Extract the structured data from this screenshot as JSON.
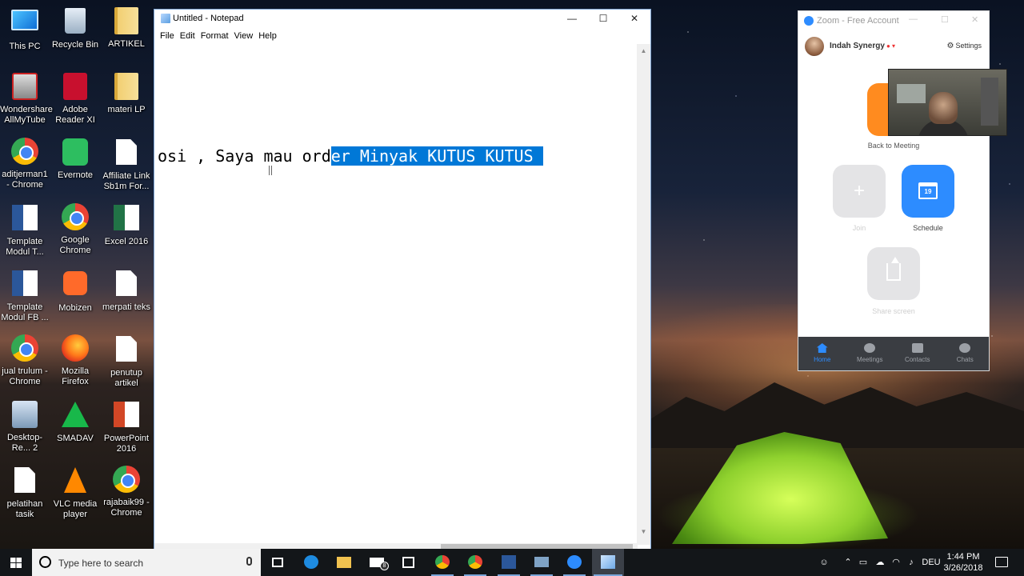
{
  "desktop": {
    "icons": [
      {
        "label": "This PC"
      },
      {
        "label": "Recycle Bin"
      },
      {
        "label": "ARTIKEL"
      },
      {
        "label": "Wondershare AllMyTube"
      },
      {
        "label": "Adobe Reader XI"
      },
      {
        "label": "materi LP"
      },
      {
        "label": "aditjerman1 - Chrome"
      },
      {
        "label": "Evernote"
      },
      {
        "label": "Affiliate Link Sb1m For..."
      },
      {
        "label": "Template Modul T..."
      },
      {
        "label": "Google Chrome"
      },
      {
        "label": "Excel 2016"
      },
      {
        "label": "Template Modul FB ..."
      },
      {
        "label": "Mobizen"
      },
      {
        "label": "merpati teks"
      },
      {
        "label": "jual trulum - Chrome"
      },
      {
        "label": "Mozilla Firefox"
      },
      {
        "label": "penutup artikel"
      },
      {
        "label": "Desktop-Re... 2"
      },
      {
        "label": "SMADAV"
      },
      {
        "label": "PowerPoint 2016"
      },
      {
        "label": "pelatihan tasik"
      },
      {
        "label": "VLC media player"
      },
      {
        "label": "rajabaik99 - Chrome"
      }
    ]
  },
  "notepad": {
    "title": "Untitled - Notepad",
    "menu": [
      "File",
      "Edit",
      "Format",
      "View",
      "Help"
    ],
    "text_before_selection": "osi , Saya mau ord",
    "selected_text": "er Minyak KUTUS KUTUS ",
    "controls": {
      "minimize": "—",
      "maximize": "☐",
      "close": "✕"
    }
  },
  "zoom": {
    "title": "Zoom - Free Account",
    "user_name": "Indah Synergy",
    "status_marker": "● ▾",
    "settings_label": "Settings",
    "back_to_meeting": "Back to Meeting",
    "join_label": "Join",
    "schedule_label": "Schedule",
    "calendar_day": "19",
    "share_screen_label": "Share screen",
    "tabs": [
      {
        "label": "Home"
      },
      {
        "label": "Meetings"
      },
      {
        "label": "Contacts"
      },
      {
        "label": "Chats"
      }
    ],
    "accent": "#2d8cff"
  },
  "taskbar": {
    "search_placeholder": "Type here to search",
    "language": "DEU",
    "mail_badge": "8",
    "time": "1:44 PM",
    "date": "3/26/2018"
  }
}
